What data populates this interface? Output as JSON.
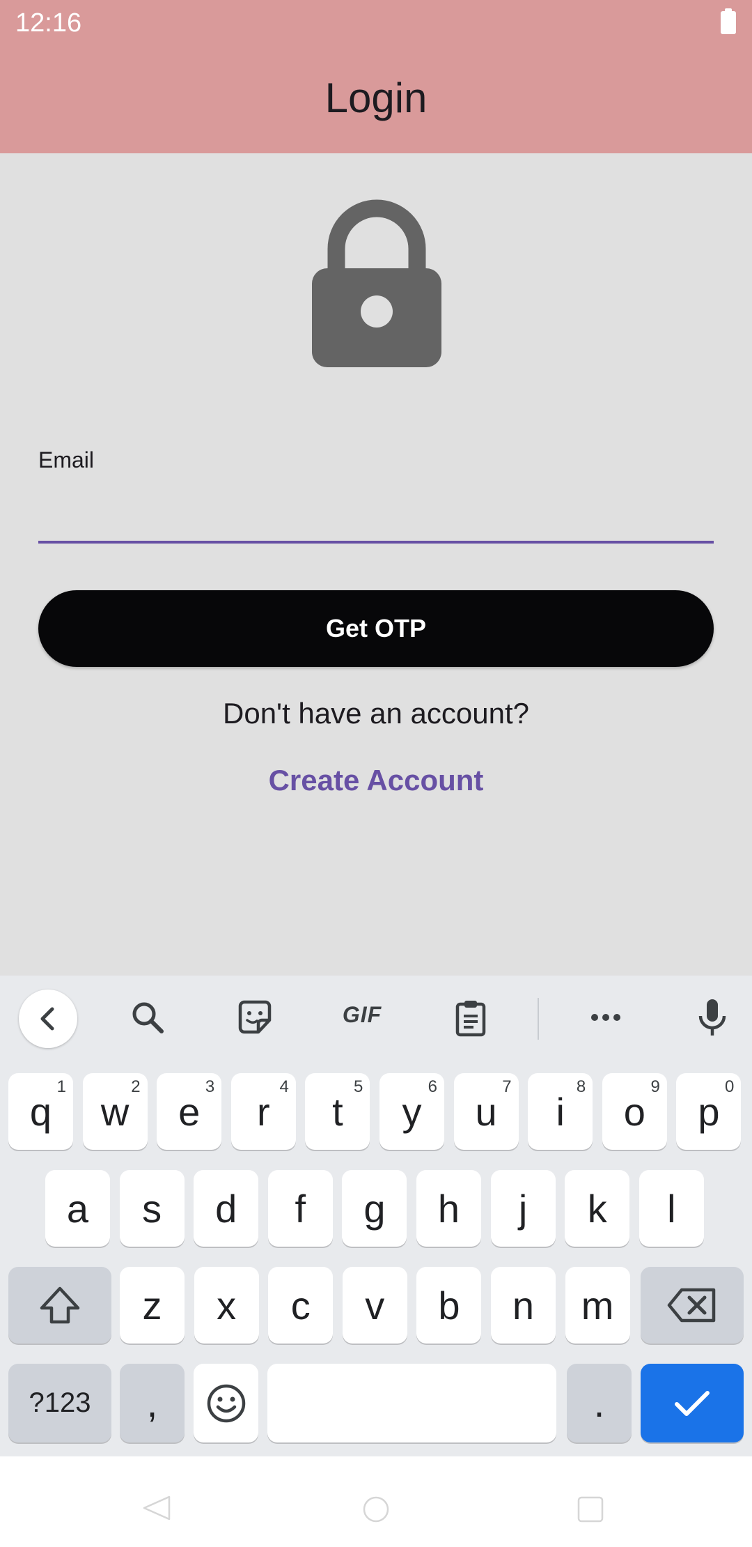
{
  "status_bar": {
    "time": "12:16"
  },
  "app_bar": {
    "title": "Login"
  },
  "form": {
    "email_label": "Email",
    "email_value": "",
    "get_otp_label": "Get OTP",
    "no_account_text": "Don't have an account?",
    "create_account_label": "Create Account"
  },
  "colors": {
    "app_bar": "#d99a9a",
    "background": "#e0e0e0",
    "accent": "#6750a4",
    "button": "#070709",
    "keyboard_action": "#1a73e8"
  },
  "icons": {
    "lock": "lock-icon",
    "toolbar": [
      "chevron-left-icon",
      "search-icon",
      "sticker-icon",
      "gif-icon",
      "clipboard-icon",
      "more-icon",
      "microphone-icon"
    ],
    "shift": "shift-icon",
    "backspace": "backspace-icon",
    "emoji": "emoji-icon",
    "enter": "checkmark-icon"
  },
  "keyboard": {
    "row1": [
      {
        "char": "q",
        "hint": "1"
      },
      {
        "char": "w",
        "hint": "2"
      },
      {
        "char": "e",
        "hint": "3"
      },
      {
        "char": "r",
        "hint": "4"
      },
      {
        "char": "t",
        "hint": "5"
      },
      {
        "char": "y",
        "hint": "6"
      },
      {
        "char": "u",
        "hint": "7"
      },
      {
        "char": "i",
        "hint": "8"
      },
      {
        "char": "o",
        "hint": "9"
      },
      {
        "char": "p",
        "hint": "0"
      }
    ],
    "row2": [
      "a",
      "s",
      "d",
      "f",
      "g",
      "h",
      "j",
      "k",
      "l"
    ],
    "row3": [
      "z",
      "x",
      "c",
      "v",
      "b",
      "n",
      "m"
    ],
    "gif_label": "GIF",
    "symbols_label": "?123",
    "comma": ",",
    "period": "."
  }
}
